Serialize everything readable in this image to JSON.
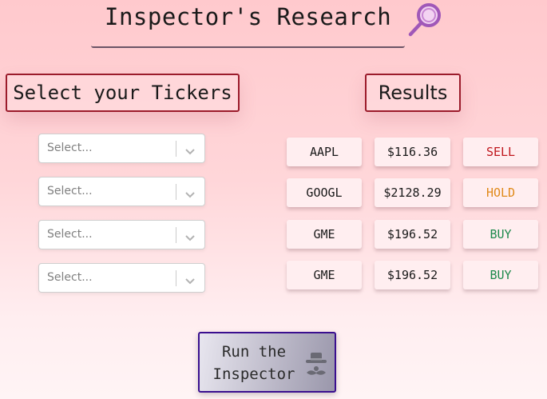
{
  "header": {
    "title": "Inspector's Research",
    "icon": "magnifying-glass-icon",
    "icon_color": "#b06ac0"
  },
  "tickers_panel": {
    "heading": "Select your Tickers",
    "selects": [
      {
        "placeholder": "Select..."
      },
      {
        "placeholder": "Select..."
      },
      {
        "placeholder": "Select..."
      },
      {
        "placeholder": "Select..."
      }
    ]
  },
  "results_panel": {
    "heading": "Results",
    "rows": [
      {
        "ticker": "AAPL",
        "price": "$116.36",
        "signal": "SELL",
        "signal_color": "#c0181e"
      },
      {
        "ticker": "GOOGL",
        "price": "$2128.29",
        "signal": "HOLD",
        "signal_color": "#e08a1a"
      },
      {
        "ticker": "GME",
        "price": "$196.52",
        "signal": "BUY",
        "signal_color": "#1e8a4c"
      },
      {
        "ticker": "GME",
        "price": "$196.52",
        "signal": "BUY",
        "signal_color": "#1e8a4c"
      }
    ]
  },
  "run_button": {
    "label_line1": "Run the",
    "label_line2": "Inspector",
    "icon": "detective-icon"
  },
  "colors": {
    "heading_border": "#9b1b2b",
    "run_border": "#3a0f8f"
  }
}
